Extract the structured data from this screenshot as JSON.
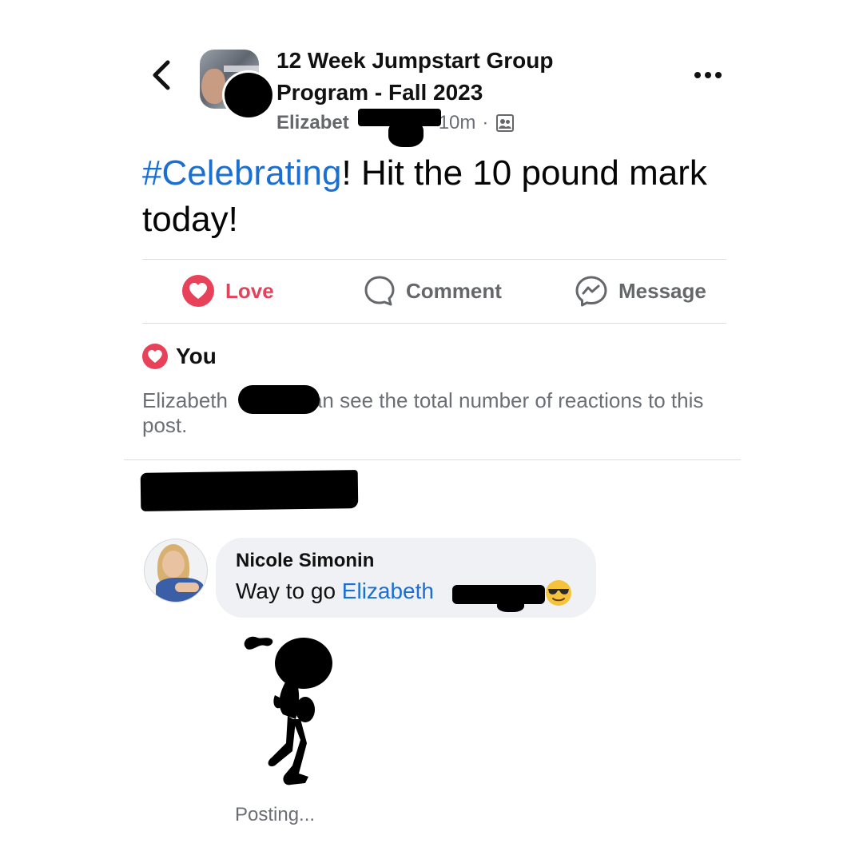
{
  "header": {
    "back_icon": "chevron-left-icon",
    "group_name": "12 Week Jumpstart Group Program - Fall 2023",
    "author_visible": "Elizabet",
    "time": "10m",
    "separator": "·",
    "audience_icon": "group-audience-icon",
    "more_icon": "more-horizontal-icon"
  },
  "post": {
    "hashtag": "#Celebrating",
    "text": "!  Hit the 10 pound mark today!"
  },
  "actions": {
    "love": "Love",
    "comment": "Comment",
    "message": "Message"
  },
  "reactions": {
    "you_label": "You",
    "notice_start": "Elizabeth",
    "notice_end": "an see the total number of reactions to this post."
  },
  "comment": {
    "name": "Nicole Simonin",
    "text_prefix": "Way to go ",
    "mention": "Elizabeth",
    "emoji": "😎",
    "status": "Posting..."
  },
  "colors": {
    "love": "#e0445c",
    "link": "#1a6fd1",
    "muted": "#65676b",
    "bubble": "#eff1f5"
  }
}
